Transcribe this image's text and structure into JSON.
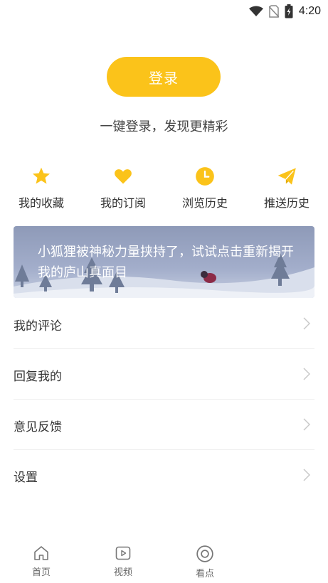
{
  "status_bar": {
    "time": "4:20",
    "icons": [
      "wifi-icon",
      "no-sim-icon",
      "battery-charging-icon"
    ]
  },
  "login": {
    "button_label": "登录",
    "tagline": "一键登录，发现更精彩"
  },
  "quick_actions": [
    {
      "label": "我的收藏",
      "icon": "star-icon"
    },
    {
      "label": "我的订阅",
      "icon": "heart-icon"
    },
    {
      "label": "浏览历史",
      "icon": "clock-icon"
    },
    {
      "label": "推送历史",
      "icon": "paper-plane-icon"
    }
  ],
  "banner": {
    "text": "小狐狸被神秘力量挟持了，试试点击重新揭开我的庐山真面目"
  },
  "menu": [
    {
      "label": "我的评论"
    },
    {
      "label": "回复我的"
    },
    {
      "label": "意见反馈"
    },
    {
      "label": "设置"
    }
  ],
  "tabbar": [
    {
      "label": "首页",
      "icon": "home-icon"
    },
    {
      "label": "视频",
      "icon": "video-icon"
    },
    {
      "label": "看点",
      "icon": "target-icon"
    }
  ],
  "colors": {
    "accent": "#fbc31a",
    "text": "#333333",
    "divider": "#eeeeee"
  }
}
